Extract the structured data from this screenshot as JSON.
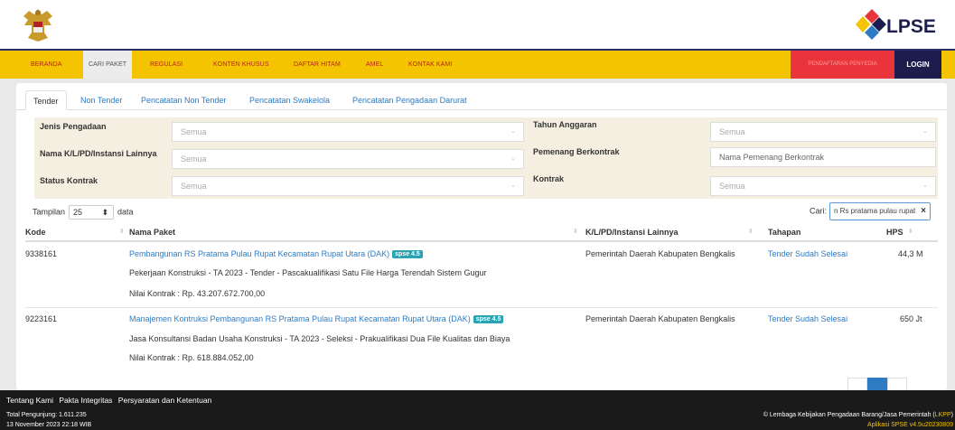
{
  "nav": {
    "items": [
      "BERANDA",
      "CARI PAKET",
      "REGULASI",
      "KONTEN KHUSUS",
      "DAFTAR HITAM",
      "AMEL",
      "KONTAK KAMI"
    ],
    "register": "PENDAFTARAN PENYEDIA",
    "login": "LOGIN"
  },
  "tabs": [
    "Tender",
    "Non Tender",
    "Pencatatan Non Tender",
    "Pencatatan Swakelola",
    "Pencatatan Pengadaan Darurat"
  ],
  "filters": {
    "jenis_label": "Jenis Pengadaan",
    "jenis_value": "Semua",
    "tahun_label": "Tahun Anggaran",
    "tahun_value": "Semua",
    "nama_label": "Nama K/L/PD/Instansi Lainnya",
    "nama_value": "Semua",
    "pemenang_label": "Pemenang Berkontrak",
    "pemenang_placeholder": "Nama Pemenang Berkontrak",
    "status_label": "Status Kontrak",
    "status_value": "Semua",
    "kontrak_label": "Kontrak",
    "kontrak_value": "Semua"
  },
  "length": {
    "prefix": "Tampilan",
    "value": "25",
    "suffix": "data"
  },
  "search": {
    "label": "Cari:",
    "value": "n Rs pratama pulau rupat"
  },
  "table": {
    "headers": [
      "Kode",
      "Nama Paket",
      "K/L/PD/Instansi Lainnya",
      "Tahapan",
      "HPS"
    ],
    "rows": [
      {
        "kode": "9338161",
        "nama": "Pembangunan RS Pratama Pulau Rupat Kecamatan Rupat Utara (DAK)",
        "badge": "spse 4.5",
        "desc": "Pekerjaan Konstruksi - TA 2023 - Tender - Pascakualifikasi Satu File Harga Terendah Sistem Gugur",
        "nilai": "Nilai Kontrak : Rp. 43.207.672.700,00",
        "instansi": "Pemerintah Daerah Kabupaten Bengkalis",
        "tahapan": "Tender Sudah Selesai",
        "hps": "44,3 M"
      },
      {
        "kode": "9223161",
        "nama": "Manajemen Kontruksi Pembangunan RS Pratama Pulau Rupat Kecamatan Rupat Utara (DAK)",
        "badge": "spse 4.5",
        "desc": "Jasa Konsultansi Badan Usaha Konstruksi - TA 2023 - Seleksi - Prakualifikasi Dua File Kualitas dan Biaya",
        "nilai": "Nilai Kontrak : Rp. 618.884.052,00",
        "instansi": "Pemerintah Daerah Kabupaten Bengkalis",
        "tahapan": "Tender Sudah Selesai",
        "hps": "650 Jt"
      }
    ]
  },
  "footer": {
    "links": [
      "Tentang Kami",
      "Pakta Integritas",
      "Persyaratan dan Ketentuan"
    ],
    "visitors": "Total Pengunjung: 1.611.235",
    "datetime": "13 November 2023 22:18 WIB",
    "copyright": "© Lembaga Kebijakan Pengadaan Barang/Jasa Pemerintah (",
    "lkpp": "LKPP",
    "copyright_end": ")",
    "version": "Aplikasi SPSE v4.5u20230809"
  },
  "colors": {
    "nav_bg": "#f5c400",
    "nav_border": "#2a2f6e",
    "link": "#2e7bc4",
    "badge": "#2aa3b3",
    "register": "#e8343a",
    "login": "#1d1d4d"
  }
}
